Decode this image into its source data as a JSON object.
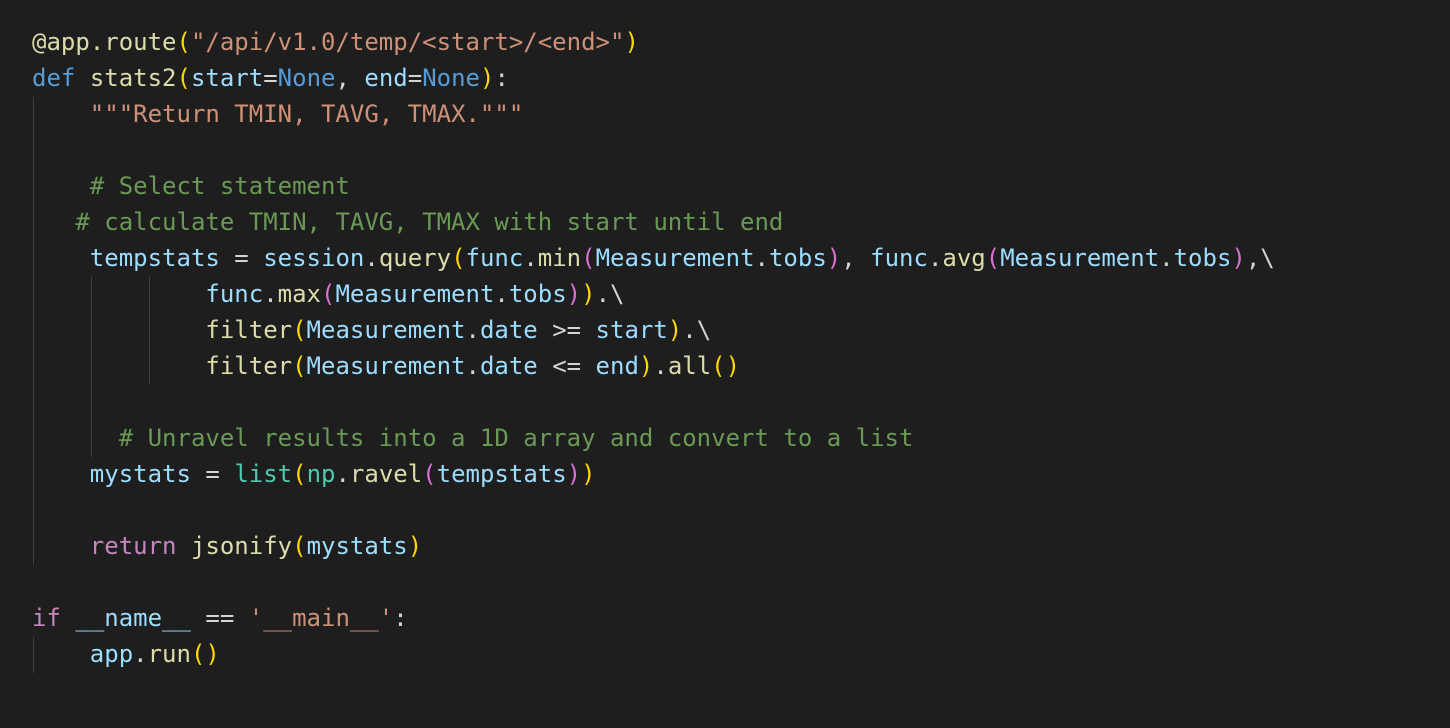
{
  "editor": {
    "language": "Python",
    "theme": "dark",
    "background": "#1e1e1e",
    "lines": [
      {
        "tokens": [
          {
            "t": "@app.route",
            "c": "dec"
          },
          {
            "t": "(",
            "c": "b1"
          },
          {
            "t": "\"/api/v1.0/temp/<start>/<end>\"",
            "c": "str"
          },
          {
            "t": ")",
            "c": "b1"
          }
        ]
      },
      {
        "tokens": [
          {
            "t": "def",
            "c": "kw"
          },
          {
            "t": " "
          },
          {
            "t": "stats2",
            "c": "fn"
          },
          {
            "t": "(",
            "c": "b1"
          },
          {
            "t": "start",
            "c": "var"
          },
          {
            "t": "=",
            "c": "op"
          },
          {
            "t": "None",
            "c": "cst"
          },
          {
            "t": ", "
          },
          {
            "t": "end",
            "c": "var"
          },
          {
            "t": "=",
            "c": "op"
          },
          {
            "t": "None",
            "c": "cst"
          },
          {
            "t": ")",
            "c": "b1"
          },
          {
            "t": ":"
          }
        ]
      },
      {
        "tokens": [
          {
            "t": "    "
          },
          {
            "t": "\"\"\"Return TMIN, TAVG, TMAX.\"\"\"",
            "c": "str"
          }
        ]
      },
      {
        "tokens": []
      },
      {
        "tokens": [
          {
            "t": "    "
          },
          {
            "t": "# Select statement",
            "c": "com"
          }
        ]
      },
      {
        "tokens": [
          {
            "t": "   "
          },
          {
            "t": "# calculate TMIN, TAVG, TMAX with start until end",
            "c": "com"
          }
        ]
      },
      {
        "tokens": [
          {
            "t": "    "
          },
          {
            "t": "tempstats",
            "c": "var"
          },
          {
            "t": " = "
          },
          {
            "t": "session",
            "c": "var"
          },
          {
            "t": "."
          },
          {
            "t": "query",
            "c": "fn"
          },
          {
            "t": "(",
            "c": "b1"
          },
          {
            "t": "func",
            "c": "var"
          },
          {
            "t": "."
          },
          {
            "t": "min",
            "c": "fn"
          },
          {
            "t": "(",
            "c": "b2"
          },
          {
            "t": "Measurement",
            "c": "var"
          },
          {
            "t": "."
          },
          {
            "t": "tobs",
            "c": "var"
          },
          {
            "t": ")",
            "c": "b2"
          },
          {
            "t": ", "
          },
          {
            "t": "func",
            "c": "var"
          },
          {
            "t": "."
          },
          {
            "t": "avg",
            "c": "fn"
          },
          {
            "t": "(",
            "c": "b2"
          },
          {
            "t": "Measurement",
            "c": "var"
          },
          {
            "t": "."
          },
          {
            "t": "tobs",
            "c": "var"
          },
          {
            "t": ")",
            "c": "b2"
          },
          {
            "t": ",\\"
          }
        ]
      },
      {
        "tokens": [
          {
            "t": "            "
          },
          {
            "t": "func",
            "c": "var"
          },
          {
            "t": "."
          },
          {
            "t": "max",
            "c": "fn"
          },
          {
            "t": "(",
            "c": "b2"
          },
          {
            "t": "Measurement",
            "c": "var"
          },
          {
            "t": "."
          },
          {
            "t": "tobs",
            "c": "var"
          },
          {
            "t": ")",
            "c": "b2"
          },
          {
            "t": ")",
            "c": "b1"
          },
          {
            "t": ".\\"
          }
        ]
      },
      {
        "tokens": [
          {
            "t": "            "
          },
          {
            "t": "filter",
            "c": "fn"
          },
          {
            "t": "(",
            "c": "b1"
          },
          {
            "t": "Measurement",
            "c": "var"
          },
          {
            "t": "."
          },
          {
            "t": "date",
            "c": "var"
          },
          {
            "t": " >= "
          },
          {
            "t": "start",
            "c": "var"
          },
          {
            "t": ")",
            "c": "b1"
          },
          {
            "t": ".\\"
          }
        ]
      },
      {
        "tokens": [
          {
            "t": "            "
          },
          {
            "t": "filter",
            "c": "fn"
          },
          {
            "t": "(",
            "c": "b1"
          },
          {
            "t": "Measurement",
            "c": "var"
          },
          {
            "t": "."
          },
          {
            "t": "date",
            "c": "var"
          },
          {
            "t": " <= "
          },
          {
            "t": "end",
            "c": "var"
          },
          {
            "t": ")",
            "c": "b1"
          },
          {
            "t": "."
          },
          {
            "t": "all",
            "c": "fn"
          },
          {
            "t": "()",
            "c": "b1"
          }
        ]
      },
      {
        "tokens": []
      },
      {
        "tokens": [
          {
            "t": "      "
          },
          {
            "t": "# Unravel results into a 1D array and convert to a list",
            "c": "com"
          }
        ]
      },
      {
        "tokens": [
          {
            "t": "    "
          },
          {
            "t": "mystats",
            "c": "var"
          },
          {
            "t": " = "
          },
          {
            "t": "list",
            "c": "cls"
          },
          {
            "t": "(",
            "c": "b1"
          },
          {
            "t": "np",
            "c": "cls"
          },
          {
            "t": "."
          },
          {
            "t": "ravel",
            "c": "fn"
          },
          {
            "t": "(",
            "c": "b2"
          },
          {
            "t": "tempstats",
            "c": "var"
          },
          {
            "t": ")",
            "c": "b2"
          },
          {
            "t": ")",
            "c": "b1"
          }
        ]
      },
      {
        "tokens": []
      },
      {
        "tokens": [
          {
            "t": "    "
          },
          {
            "t": "return",
            "c": "ctl"
          },
          {
            "t": " "
          },
          {
            "t": "jsonify",
            "c": "fn"
          },
          {
            "t": "(",
            "c": "b1"
          },
          {
            "t": "mystats",
            "c": "var"
          },
          {
            "t": ")",
            "c": "b1"
          }
        ]
      },
      {
        "tokens": []
      },
      {
        "tokens": [
          {
            "t": "if",
            "c": "ctl"
          },
          {
            "t": " "
          },
          {
            "t": "__name__",
            "c": "var"
          },
          {
            "t": " == "
          },
          {
            "t": "'__main__'",
            "c": "str"
          },
          {
            "t": ":"
          }
        ]
      },
      {
        "tokens": [
          {
            "t": "    "
          },
          {
            "t": "app",
            "c": "var"
          },
          {
            "t": "."
          },
          {
            "t": "run",
            "c": "fn"
          },
          {
            "t": "()",
            "c": "b1"
          }
        ]
      }
    ]
  }
}
